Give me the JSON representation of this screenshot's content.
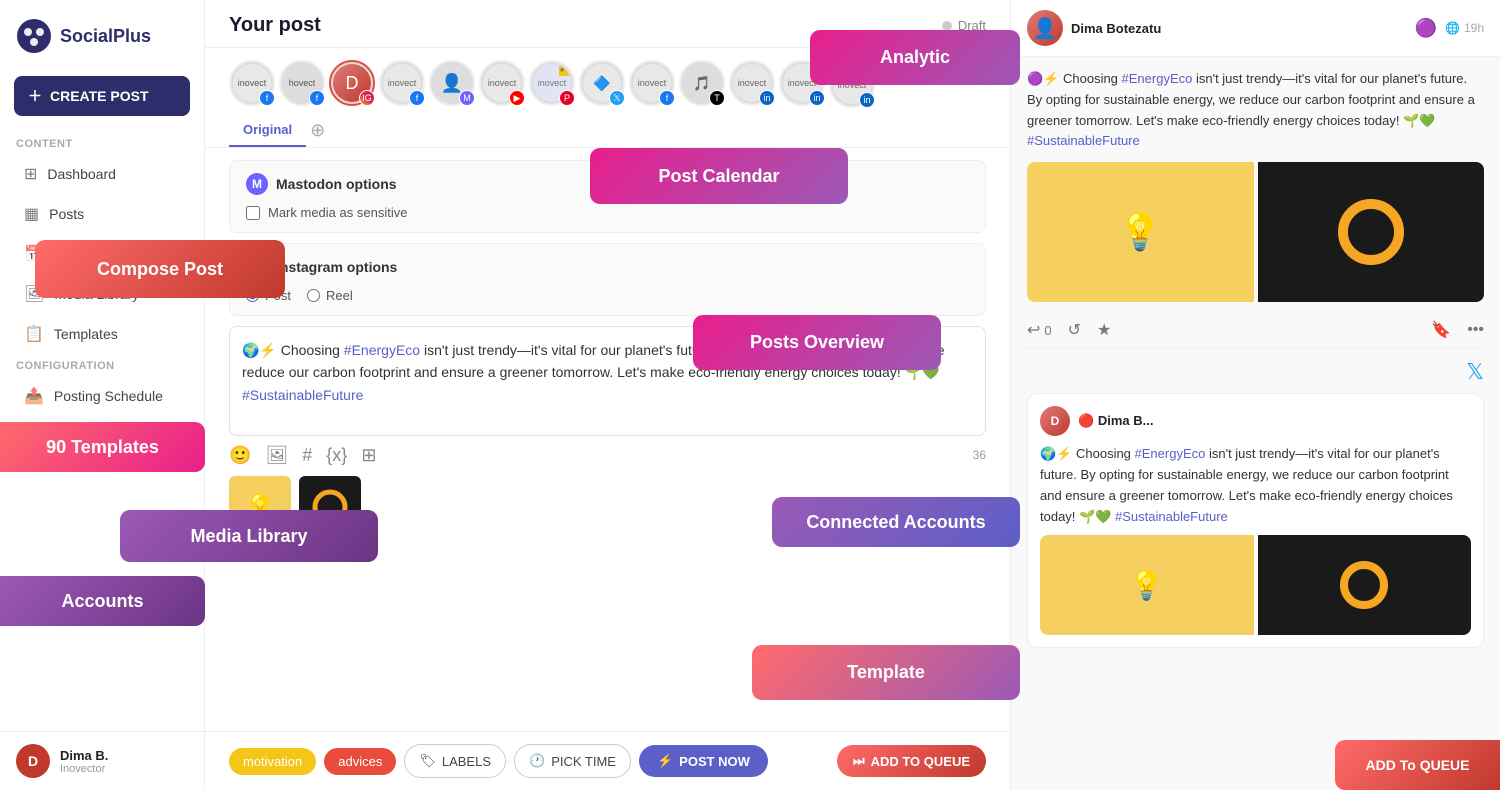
{
  "app": {
    "name": "SocialPlus",
    "logo_icon": "⬡"
  },
  "sidebar": {
    "create_post_label": "CREATE POST",
    "sections": [
      {
        "label": "Content",
        "items": [
          {
            "id": "dashboard",
            "label": "Dashboard",
            "icon": "⊞"
          },
          {
            "id": "posts",
            "label": "Posts",
            "icon": "▦"
          },
          {
            "id": "calendar",
            "label": "Calendar",
            "icon": "📅"
          },
          {
            "id": "media-library",
            "label": "Media Library",
            "icon": "🖼"
          },
          {
            "id": "templates",
            "label": "Templates",
            "icon": "📋"
          }
        ]
      },
      {
        "label": "Configuration",
        "items": [
          {
            "id": "posting-schedule",
            "label": "Posting Schedule",
            "icon": "📤"
          },
          {
            "id": "accounts",
            "label": "Accounts",
            "icon": "📦"
          }
        ]
      }
    ],
    "user": {
      "name": "Dima B.",
      "company": "Inovector",
      "initial": "D"
    }
  },
  "main": {
    "post_title": "Your post",
    "draft_label": "Draft",
    "tabs": [
      {
        "label": "Original",
        "active": true
      }
    ],
    "mastodon_options": {
      "header": "Mastodon options",
      "mark_sensitive_label": "Mark media as sensitive"
    },
    "instagram_options": {
      "header": "Instagram options",
      "post_type_post": "Post",
      "post_type_reel": "Reel"
    },
    "post_text": "🌍⚡ Choosing #EnergyEco isn't just trendy—it's vital for our planet's future. By opting for sustainable energy, we reduce our carbon footprint and ensure a greener tomorrow. Let's make eco-friendly energy choices today! 🌱💚 #SustainableFuture",
    "char_count": "36",
    "toolbar": {
      "emoji_icon": "😊",
      "image_icon": "🖼",
      "hashtag_icon": "#",
      "variable_icon": "{x}",
      "grid_icon": "⊞"
    },
    "bottom_bar": {
      "tag_motivation": "motivation",
      "tag_advices": "advices",
      "labels_btn": "LABELS",
      "pick_time_btn": "PICK TIME",
      "post_now_btn": "POST NOW",
      "add_to_queue_btn": "ADD TO QUEUE"
    }
  },
  "right_panel": {
    "user_name": "Dima Botezatu",
    "time_ago": "19h",
    "post_text": "🌍⚡ Choosing #EnergyEco isn't just trendy—it's vital for our planet's future. By opting for sustainable energy, we reduce our carbon footprint and ensure a greener tomorrow. Let's make eco-friendly energy choices today! 🌱💚 #SustainableFuture",
    "actions": {
      "reply_count": "0",
      "retweet_icon": "↺",
      "like_icon": "★",
      "bookmark_icon": "🔖",
      "more_icon": "•••"
    },
    "second_tweet": {
      "user_name": "Dima B...",
      "text": "🌍⚡ Choosing #EnergyEco isn't just trendy—it's vital for our planet's future. By opting for sustainable energy, we reduce our carbon footprint and ensure a greener tomorrow. Let's make eco-friendly energy choices today! 🌱💚 #SustainableFuture"
    }
  },
  "overlays": {
    "compose_post": "Compose Post",
    "post_calendar": "Post Calendar",
    "posts_overview": "Posts Overview",
    "media_library": "Media Library",
    "ninety_templates": "90 Templates",
    "accounts": "Accounts",
    "analytic": "Analytic",
    "connected_accounts": "Connected  Accounts",
    "template": "Template",
    "add_to_queue": "ADD To QUEUE"
  }
}
